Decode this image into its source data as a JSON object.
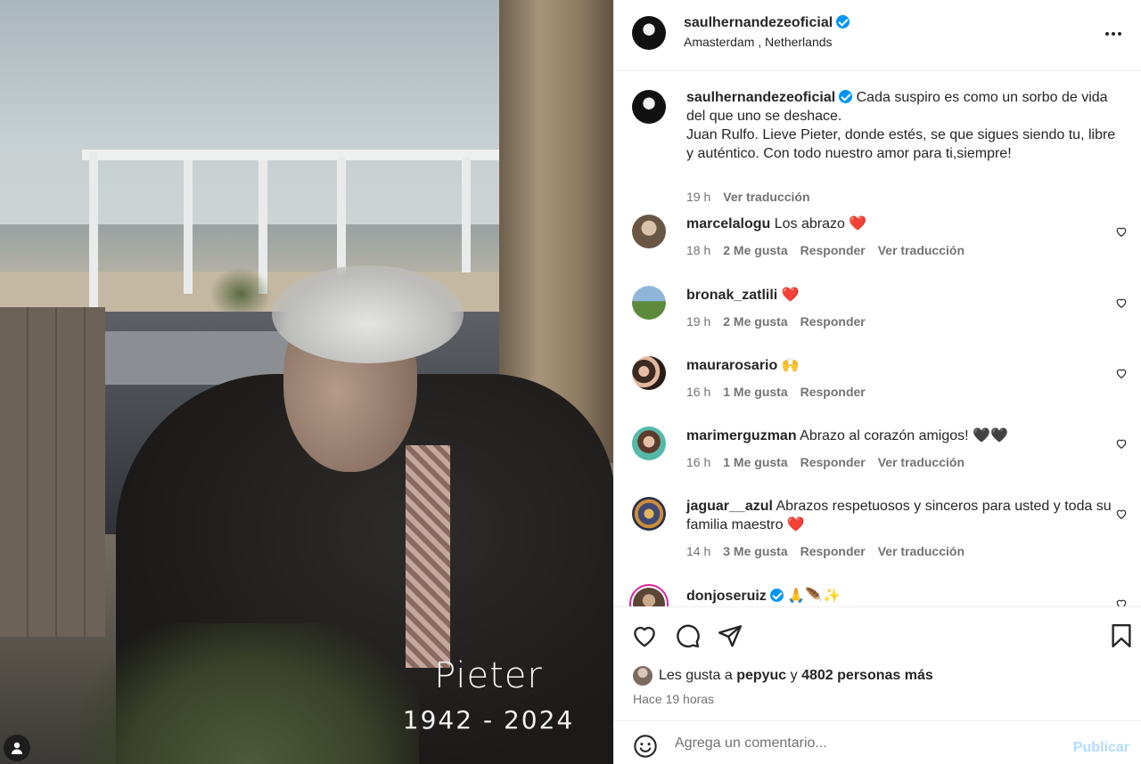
{
  "photo": {
    "overlay_name": "Pieter",
    "overlay_years": "1942 - 2024"
  },
  "header": {
    "username": "saulhernandezeoficial",
    "verified": true,
    "location": "Amasterdam , Netherlands",
    "more_icon": "more-horizontal-icon"
  },
  "caption": {
    "username": "saulhernandezeoficial",
    "text": "Cada suspiro es como un sorbo de vida del que uno se deshace.\nJuan Rulfo. Lieve Pieter, donde estés, se que sigues siendo tu, libre y auténtico. Con todo nuestro amor para ti,siempre!",
    "time": "19 h",
    "translate": "Ver traducción"
  },
  "comments": [
    {
      "username": "marcelalogu",
      "text": "Los abrazo ❤️",
      "time": "18 h",
      "likes": "2 Me gusta",
      "reply": "Responder",
      "translate": "Ver traducción"
    },
    {
      "username": "bronak_zatlili",
      "text": "❤️",
      "time": "19 h",
      "likes": "2 Me gusta",
      "reply": "Responder",
      "translate": ""
    },
    {
      "username": "maurarosario",
      "text": "🙌",
      "time": "16 h",
      "likes": "1 Me gusta",
      "reply": "Responder",
      "translate": ""
    },
    {
      "username": "marimerguzman",
      "text": "Abrazo al corazón amigos! 🖤🖤",
      "time": "16 h",
      "likes": "1 Me gusta",
      "reply": "Responder",
      "translate": "Ver traducción"
    },
    {
      "username": "jaguar__azul",
      "text": "Abrazos respetuosos y sinceros para usted y toda su familia maestro ❤️",
      "time": "14 h",
      "likes": "3 Me gusta",
      "reply": "Responder",
      "translate": "Ver traducción"
    },
    {
      "username": "donjoseruiz",
      "text": "🙏🪶✨",
      "verified": true
    }
  ],
  "actions": {
    "like_icon": "heart-icon",
    "comment_icon": "comment-icon",
    "share_icon": "send-icon",
    "save_icon": "bookmark-icon",
    "likes_prefix": "Les gusta a",
    "likes_user": "pepyuc",
    "likes_and": "y",
    "likes_others": "4802 personas más",
    "posted": "Hace 19 horas"
  },
  "comment_box": {
    "placeholder": "Agrega un comentario...",
    "post_label": "Publicar",
    "emoji_icon": "emoji-icon"
  },
  "colors": {
    "accent": "#0095f6",
    "text": "#262626",
    "muted": "#737373",
    "post_disabled": "#b3dbff",
    "heart_red": "#ed4956"
  }
}
